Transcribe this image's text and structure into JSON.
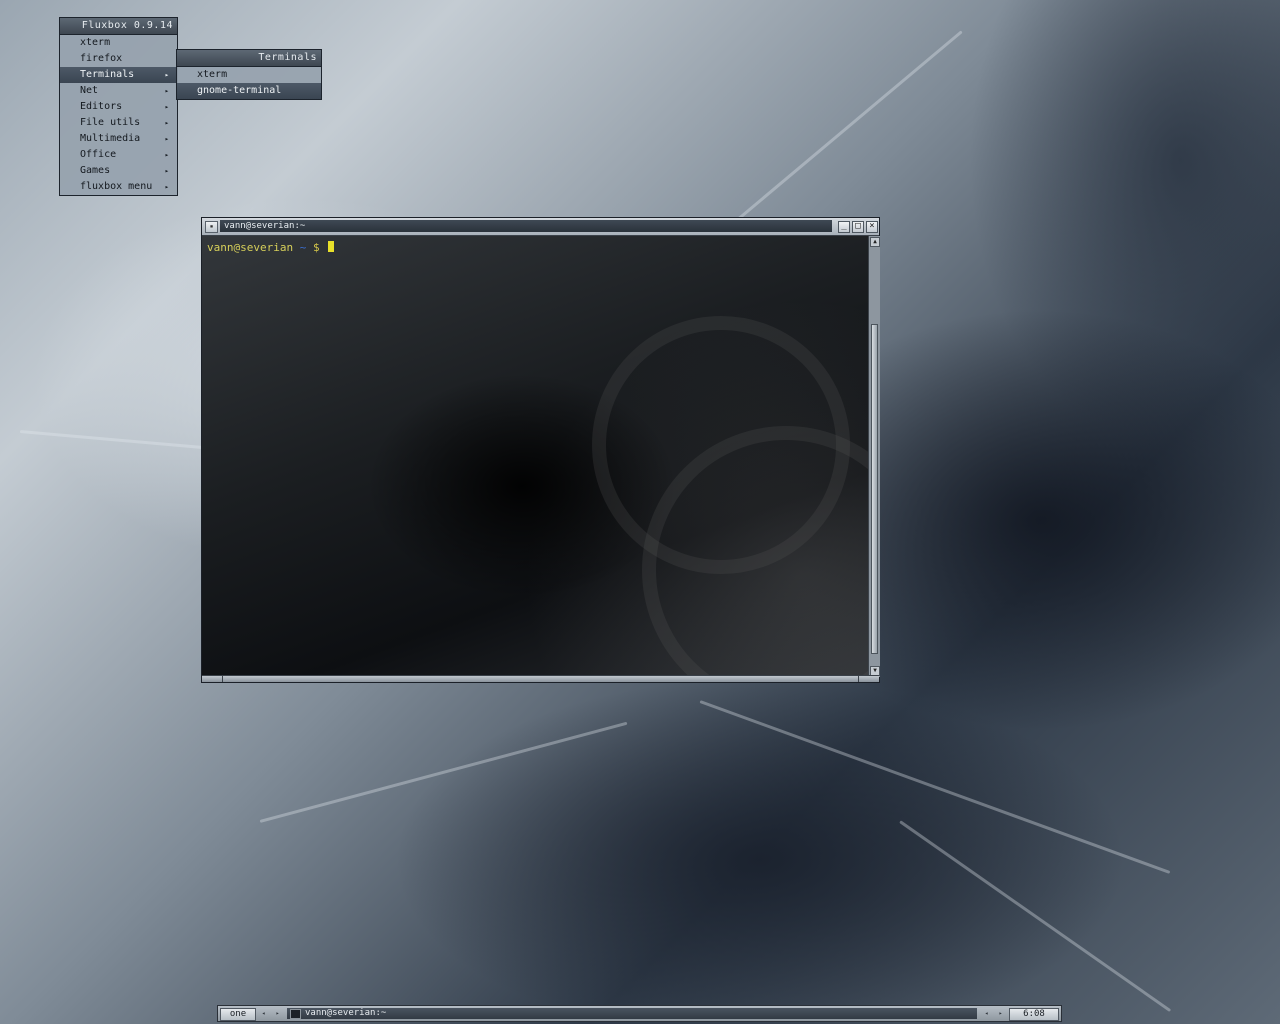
{
  "fluxbox_menu": {
    "title": "Fluxbox 0.9.14",
    "items": [
      {
        "label": "xterm",
        "arrow": ""
      },
      {
        "label": "firefox",
        "arrow": ""
      },
      {
        "label": "Terminals",
        "arrow": "▸"
      },
      {
        "label": "Net",
        "arrow": "▸"
      },
      {
        "label": "Editors",
        "arrow": "▸"
      },
      {
        "label": "File utils",
        "arrow": "▸"
      },
      {
        "label": "Multimedia",
        "arrow": "▸"
      },
      {
        "label": "Office",
        "arrow": "▸"
      },
      {
        "label": "Games",
        "arrow": "▸"
      },
      {
        "label": "fluxbox menu",
        "arrow": "▸"
      }
    ]
  },
  "terminals_submenu": {
    "title": "Terminals",
    "items": [
      {
        "label": "xterm"
      },
      {
        "label": "gnome-terminal"
      }
    ]
  },
  "terminal_window": {
    "title": "vann@severian:~",
    "prompt_user": "vann@severian",
    "prompt_dir": " ~ ",
    "prompt_symbol": "$"
  },
  "toolbar": {
    "workspace": "one",
    "prev_arrow": "◂",
    "next_arrow": "▸",
    "task_title": "vann@severian:~",
    "clock": "6:08"
  },
  "colors": {
    "prompt_user": "#d6cf5a",
    "prompt_dir": "#3b6fd1",
    "cursor": "#e8e02a"
  }
}
